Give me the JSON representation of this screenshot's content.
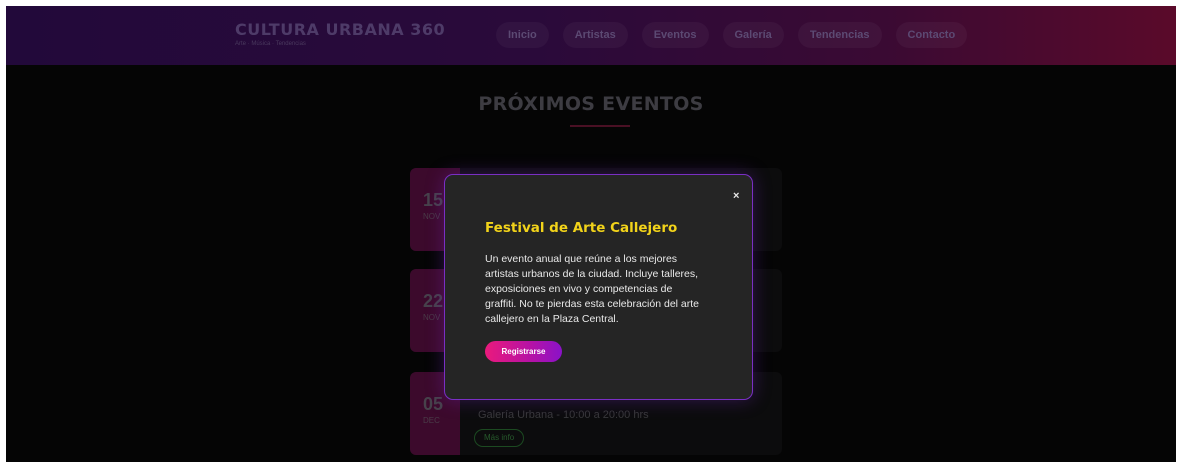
{
  "header": {
    "brand_title": "CULTURA URBANA 360",
    "brand_tagline": "Arte · Música · Tendencias",
    "nav": [
      {
        "label": "Inicio"
      },
      {
        "label": "Artistas"
      },
      {
        "label": "Eventos"
      },
      {
        "label": "Galería"
      },
      {
        "label": "Tendencias"
      },
      {
        "label": "Contacto"
      }
    ]
  },
  "events_section": {
    "title": "PRÓXIMOS EVENTOS",
    "events": [
      {
        "day": "15",
        "month": "NOV"
      },
      {
        "day": "22",
        "month": "NOV"
      },
      {
        "day": "05",
        "month": "DEC",
        "details": "Galería Urbana - 10:00 a 20:00 hrs",
        "button_label": "Más info"
      }
    ]
  },
  "modal": {
    "close_label": "×",
    "title": "Festival de Arte Callejero",
    "description_lines": [
      "Un evento anual que reúne a los mejores",
      "artistas urbanos de la ciudad. Incluye talleres,",
      "exposiciones en vivo y competencias de",
      "graffiti. No te pierdas esta celebración del arte",
      "callejero en la Plaza Central."
    ],
    "register_label": "Registrarse"
  },
  "colors": {
    "modal_title": "#f2d31a",
    "modal_border": "#7a2fc4",
    "button_gradient_start": "#ea1a7c",
    "button_gradient_end": "#8a12c8"
  }
}
